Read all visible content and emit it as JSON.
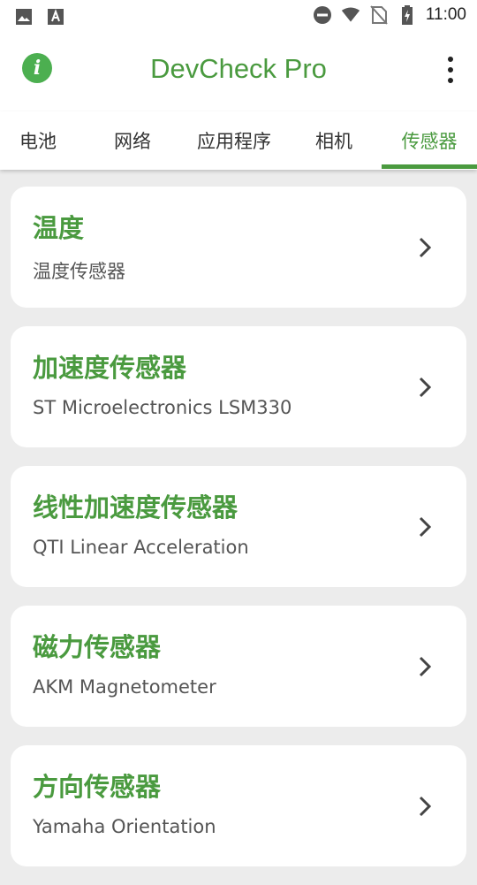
{
  "status_bar": {
    "time": "11:00",
    "icons": [
      "image-icon",
      "text-a-icon",
      "do-not-disturb-icon",
      "wifi-icon",
      "no-sim-icon",
      "battery-charging-icon"
    ]
  },
  "app_bar": {
    "title": "DevCheck Pro",
    "info_icon": "info-icon",
    "menu_icon": "more-vert-icon"
  },
  "tabs": [
    {
      "label": "电池",
      "active": false
    },
    {
      "label": "网络",
      "active": false
    },
    {
      "label": "应用程序",
      "active": false
    },
    {
      "label": "相机",
      "active": false
    },
    {
      "label": "传感器",
      "active": true
    }
  ],
  "sensors": [
    {
      "title": "温度",
      "subtitle": "温度传感器"
    },
    {
      "title": "加速度传感器",
      "subtitle": "ST Microelectronics LSM330"
    },
    {
      "title": "线性加速度传感器",
      "subtitle": "QTI Linear Acceleration"
    },
    {
      "title": "磁力传感器",
      "subtitle": "AKM Magnetometer"
    },
    {
      "title": "方向传感器",
      "subtitle": "Yamaha Orientation"
    }
  ],
  "colors": {
    "accent": "#4a9a3f",
    "background": "#ececec",
    "card": "#ffffff"
  }
}
